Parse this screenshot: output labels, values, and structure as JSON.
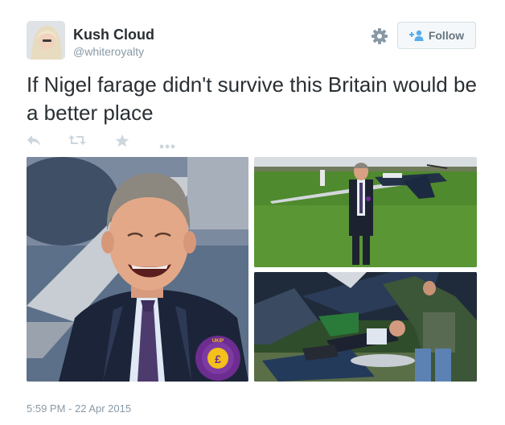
{
  "tweet": {
    "author": {
      "full_name": "Kush Cloud",
      "username": "@whiteroyalty"
    },
    "follow_label": "Follow",
    "text": "If Nigel farage didn't survive this Britain would be a better place",
    "timestamp": "5:59 PM - 22 Apr 2015",
    "actions": [
      "reply-icon",
      "retweet-icon",
      "favorite-icon",
      "more-icon"
    ],
    "photos": [
      {
        "name": "photo-laughing-man-with-ukip-rosette",
        "badge_text": "UKIP"
      },
      {
        "name": "photo-man-standing-near-crashed-plane"
      },
      {
        "name": "photo-man-in-plane-wreckage"
      }
    ]
  },
  "colors": {
    "text": "#292f33",
    "secondary": "#8899a6",
    "action_icon": "#ccd6dd",
    "follow_bg": "#f5f8fa",
    "follow_icon": "#55acee",
    "ukip_purple": "#6d2c8f",
    "ukip_yellow": "#f3c01c"
  }
}
